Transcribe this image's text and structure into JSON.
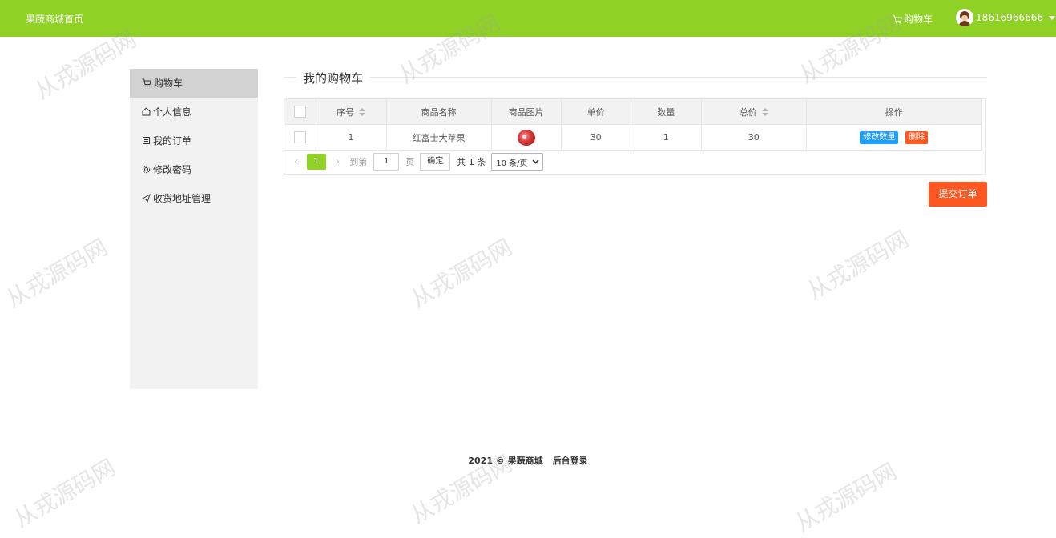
{
  "header": {
    "brand": "果蔬商城首页",
    "cart_label": "购物车",
    "user_phone": "18616966666"
  },
  "sidebar": {
    "items": [
      {
        "label": "购物车",
        "icon": "cart-icon",
        "active": true
      },
      {
        "label": "个人信息",
        "icon": "home-icon"
      },
      {
        "label": "我的订单",
        "icon": "list-icon"
      },
      {
        "label": "修改密码",
        "icon": "gear-icon"
      },
      {
        "label": "收货地址管理",
        "icon": "send-icon"
      }
    ]
  },
  "main": {
    "title": "我的购物车",
    "table": {
      "columns": [
        "序号",
        "商品名称",
        "商品图片",
        "单价",
        "数量",
        "总价",
        "操作"
      ],
      "rows": [
        {
          "index": "1",
          "name": "红富士大苹果",
          "image": "apple-image",
          "price": "30",
          "quantity": "1",
          "total": "30",
          "edit_label": "修改数量",
          "delete_label": "删除"
        }
      ]
    },
    "pager": {
      "current_page": "1",
      "goto_label": "到第",
      "page_input": "1",
      "page_suffix": "页",
      "confirm_label": "确定",
      "total_label": "共 1 条",
      "page_size": "10 条/页"
    },
    "submit_label": "提交订单"
  },
  "footer": {
    "copyright": "2021 © 果蔬商城",
    "admin_login": "后台登录"
  },
  "watermark": "从戎源码网",
  "colors": {
    "accent": "#8fd124",
    "danger": "#ff5722",
    "info": "#1e9fff"
  }
}
